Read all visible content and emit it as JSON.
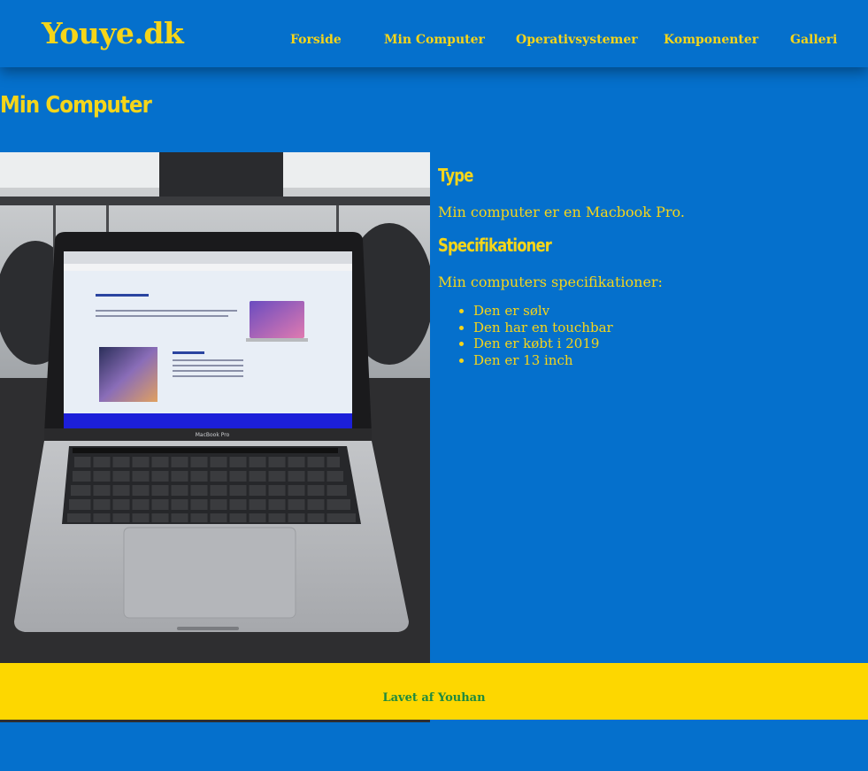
{
  "site": {
    "logo": "Youye.dk"
  },
  "nav": {
    "items": [
      {
        "label": "Forside"
      },
      {
        "label": "Min Computer"
      },
      {
        "label": "Operativsystemer"
      },
      {
        "label": "Komponenter"
      },
      {
        "label": "Galleri"
      }
    ]
  },
  "page": {
    "title": "Min Computer"
  },
  "photo": {
    "screen_label": "MacBook Pro"
  },
  "type_section": {
    "heading": "Type",
    "text": "Min computer er en Macbook Pro."
  },
  "specs_section": {
    "heading": "Specifikationer",
    "intro": "Min computers specifikationer:",
    "items": [
      "Den er sølv",
      "Den har en touchbar",
      "Den er købt i 2019",
      "Den er 13 inch"
    ]
  },
  "footer": {
    "text": "Lavet af Youhan"
  },
  "colors": {
    "background": "#0570cc",
    "accent_text": "#f5d51a",
    "footer_bg": "#fdd700",
    "footer_text": "#1e8a3e"
  }
}
